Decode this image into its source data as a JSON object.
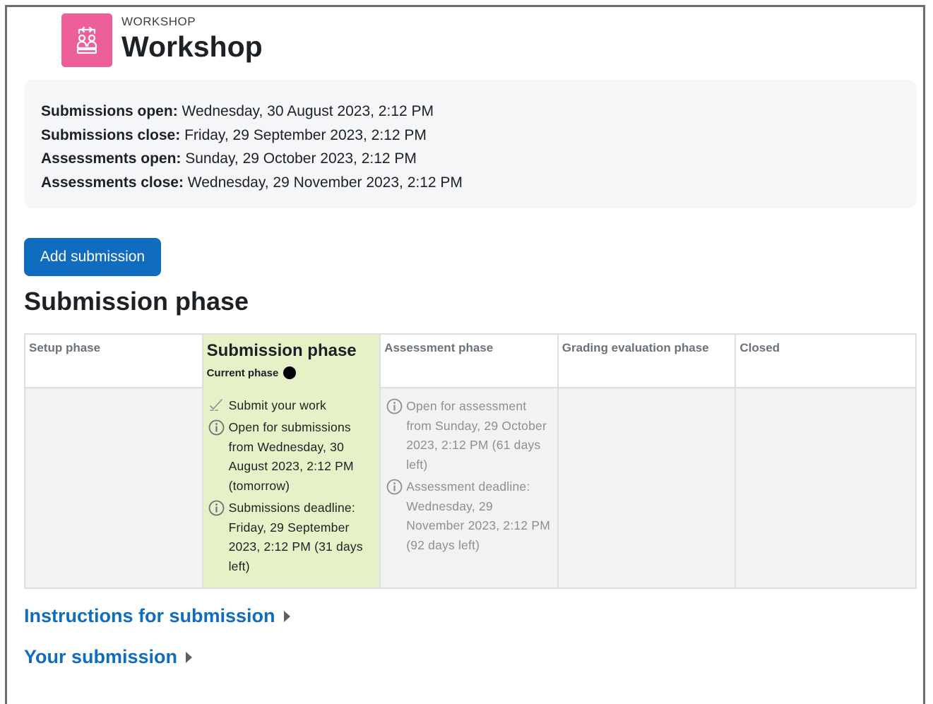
{
  "module": {
    "type_label": "WORKSHOP",
    "title": "Workshop",
    "icon": "workshop-icon",
    "icon_color": "#ec5f9b"
  },
  "dates": [
    {
      "label": "Submissions open:",
      "value": "Wednesday, 30 August 2023, 2:12 PM"
    },
    {
      "label": "Submissions close:",
      "value": "Friday, 29 September 2023, 2:12 PM"
    },
    {
      "label": "Assessments open:",
      "value": "Sunday, 29 October 2023, 2:12 PM"
    },
    {
      "label": "Assessments close:",
      "value": "Wednesday, 29 November 2023, 2:12 PM"
    }
  ],
  "actions": {
    "add_submission": "Add submission",
    "primary_color": "#0f6cbf"
  },
  "current_phase_heading": "Submission phase",
  "phases": [
    {
      "name": "Setup phase"
    },
    {
      "name": "Submission phase",
      "current_label": "Current phase",
      "highlight_color": "#e7f1c7"
    },
    {
      "name": "Assessment phase"
    },
    {
      "name": "Grading evaluation phase"
    },
    {
      "name": "Closed"
    }
  ],
  "submission_tasks": [
    {
      "icon": "check-todo-icon",
      "text": "Submit your work"
    },
    {
      "icon": "info-icon",
      "text": "Open for submissions from Wednesday, 30 August 2023, 2:12 PM (tomorrow)"
    },
    {
      "icon": "info-icon",
      "text": "Submissions deadline: Friday, 29 September 2023, 2:12 PM (31 days left)"
    }
  ],
  "assessment_tasks": [
    {
      "icon": "info-icon",
      "text": "Open for assessment from Sunday, 29 October 2023, 2:12 PM (61 days left)"
    },
    {
      "icon": "info-icon",
      "text": "Assessment deadline: Wednesday, 29 November 2023, 2:12 PM (92 days left)"
    }
  ],
  "sections": {
    "instructions": "Instructions for submission",
    "your_submission": "Your submission"
  }
}
